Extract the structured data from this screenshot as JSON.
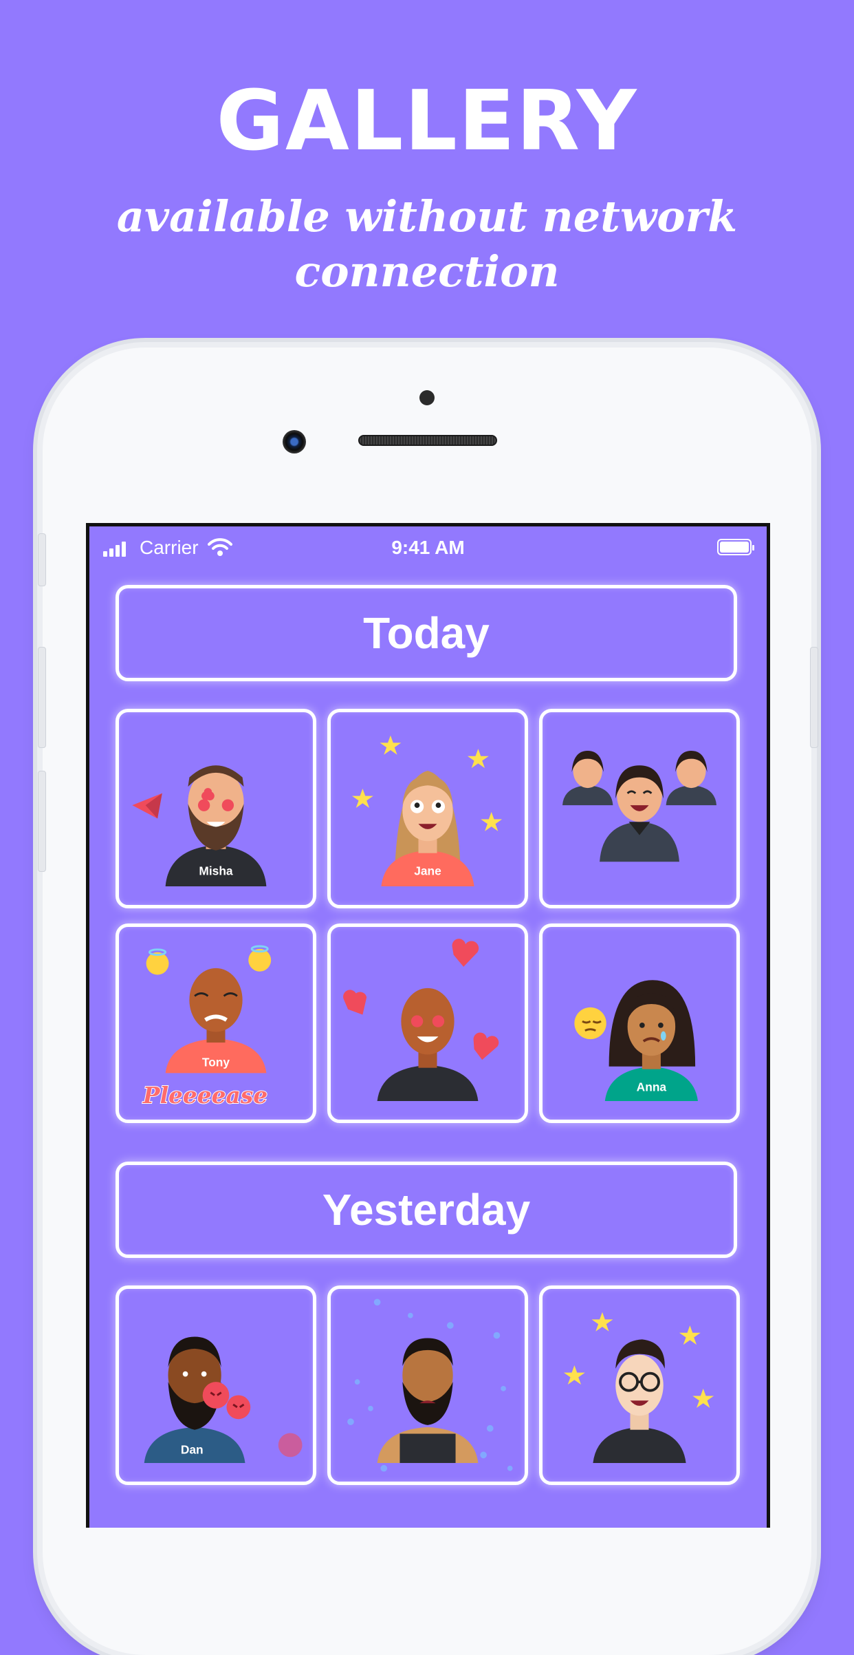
{
  "promo": {
    "headline": "GALLERY",
    "subhead": "available without network connection"
  },
  "status_bar": {
    "carrier": "Carrier",
    "time": "9:41 AM"
  },
  "sections": [
    {
      "title": "Today",
      "stickers": [
        {
          "name": "Misha",
          "icon": "paper-plane-icon"
        },
        {
          "name": "Jane",
          "icon": "star-icon"
        },
        {
          "name": "",
          "icon": "group-laughing-icon"
        },
        {
          "name": "Tony",
          "caption": "Pleeeease",
          "icon": "halo-smiley-icon"
        },
        {
          "name": "",
          "icon": "heart-icon"
        },
        {
          "name": "Anna",
          "icon": "pensive-face-icon"
        }
      ]
    },
    {
      "title": "Yesterday",
      "stickers": [
        {
          "name": "Dan",
          "icon": "angry-face-icon"
        },
        {
          "name": "",
          "icon": "bubbles-icon"
        },
        {
          "name": "",
          "icon": "star-icon"
        }
      ]
    }
  ],
  "colors": {
    "background": "#9279fe",
    "accent_red": "#f04b5b",
    "star_yellow": "#ffe14d",
    "phone_white": "#f8f9fb"
  }
}
